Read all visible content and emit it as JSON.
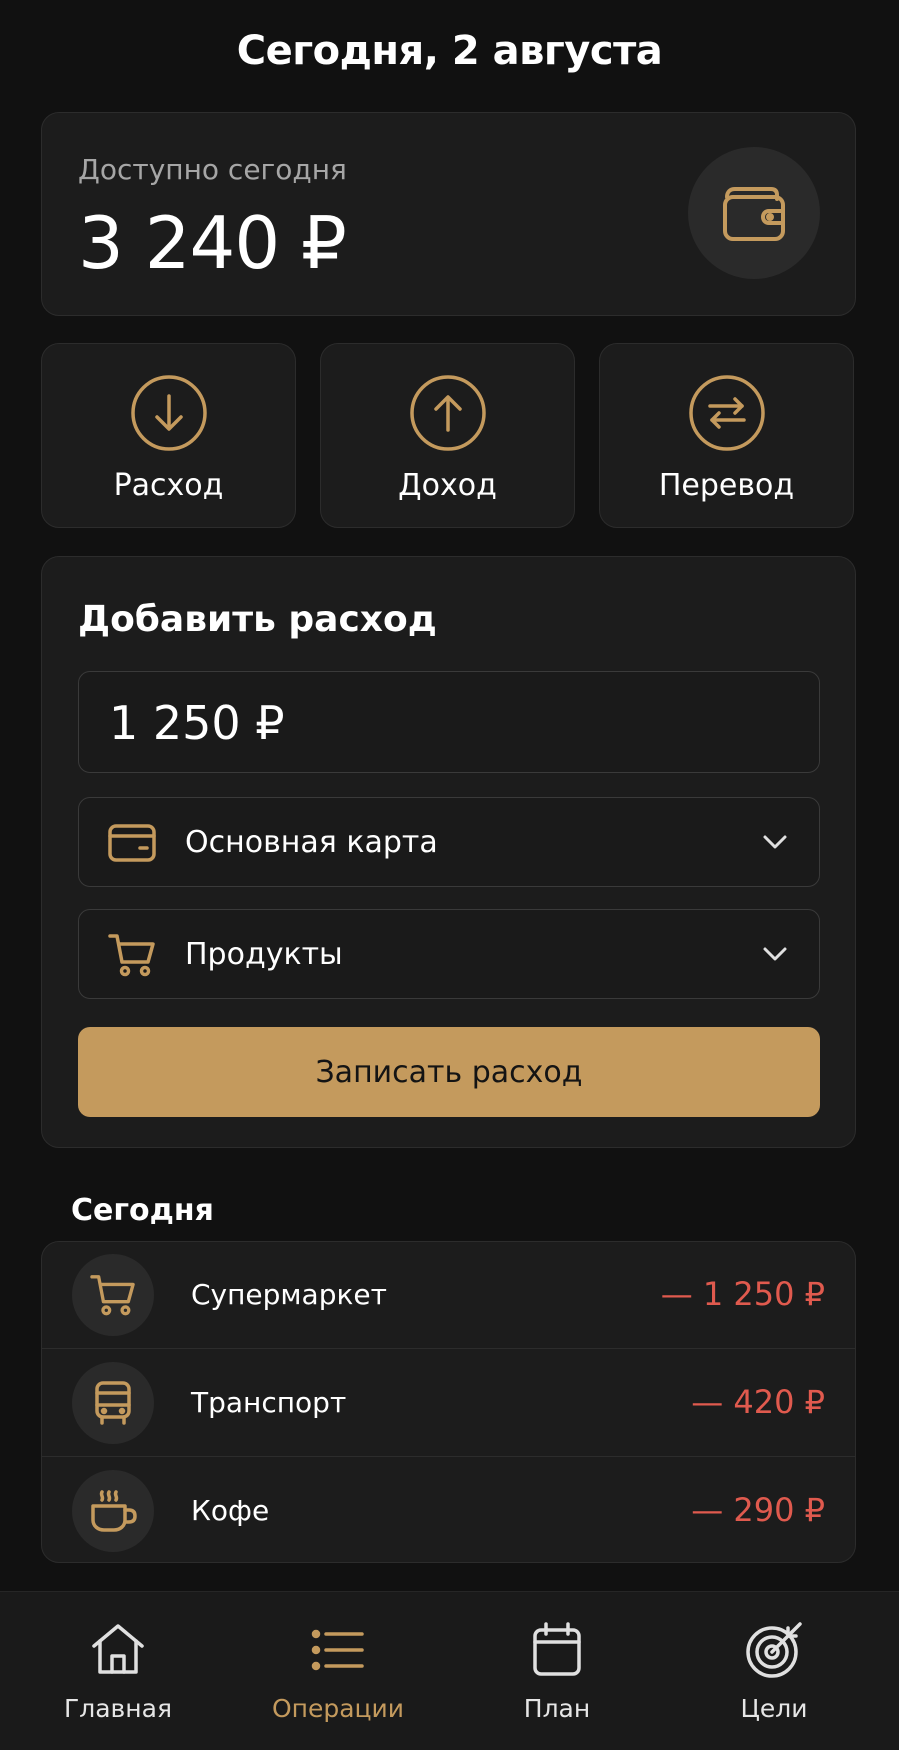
{
  "header": {
    "title": "Сегодня, 2 августа"
  },
  "balance": {
    "label": "Доступно сегодня",
    "value": "3 240 ₽",
    "icon": "wallet-icon"
  },
  "actions": [
    {
      "label": "Расход",
      "icon": "arrow-down-circle-icon"
    },
    {
      "label": "Доход",
      "icon": "arrow-up-circle-icon"
    },
    {
      "label": "Перевод",
      "icon": "transfer-icon"
    }
  ],
  "add_expense": {
    "title": "Добавить расход",
    "amount": "1 250 ₽",
    "account": {
      "value": "Основная карта",
      "icon": "card-icon"
    },
    "category": {
      "value": "Продукты",
      "icon": "cart-icon"
    },
    "submit_label": "Записать расход"
  },
  "today": {
    "title": "Сегодня",
    "items": [
      {
        "name": "Супермаркет",
        "amount": "— 1 250 ₽",
        "icon": "cart-icon"
      },
      {
        "name": "Транспорт",
        "amount": "— 420 ₽",
        "icon": "bus-icon"
      },
      {
        "name": "Кофе",
        "amount": "— 290 ₽",
        "icon": "coffee-icon"
      }
    ]
  },
  "nav": {
    "active": "Операции",
    "items": [
      {
        "label": "Главная",
        "icon": "home-icon"
      },
      {
        "label": "Операции",
        "icon": "list-icon"
      },
      {
        "label": "План",
        "icon": "calendar-icon"
      },
      {
        "label": "Цели",
        "icon": "target-icon"
      }
    ]
  },
  "colors": {
    "background": "#111111",
    "card": "#1c1c1c",
    "accent": "#c49a5d",
    "expense": "#e05a4e"
  }
}
